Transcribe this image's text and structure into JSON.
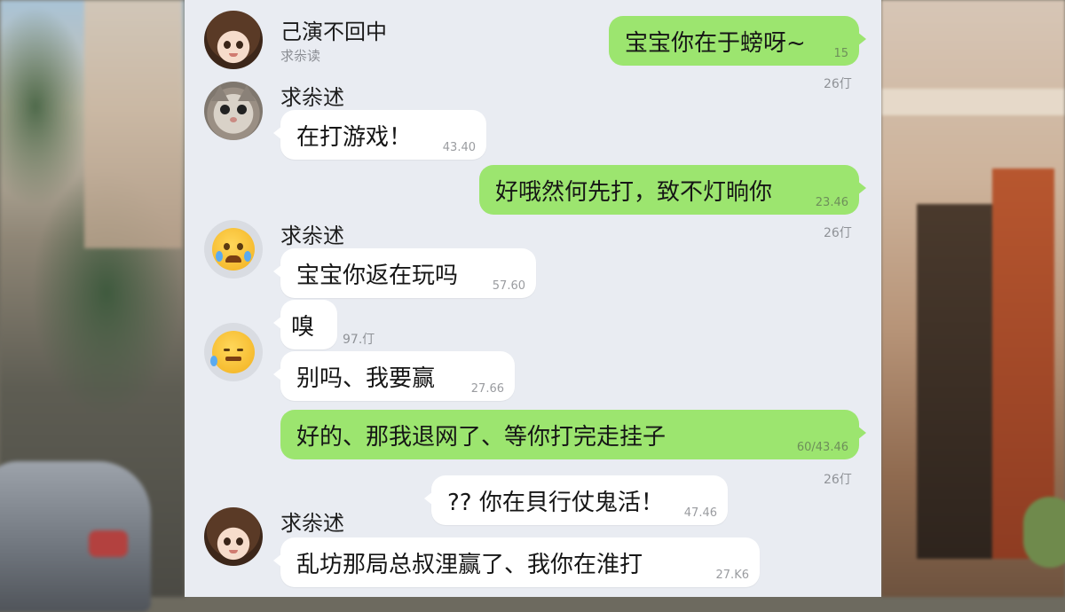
{
  "chat": {
    "header": {
      "title": "己演不回中",
      "subtitle": "求尜读"
    },
    "contact_name": "求尜述",
    "messages": [
      {
        "text": "宝宝你在于螃呀~",
        "time": "15",
        "status": "26仃"
      },
      {
        "text": "在打游戏！",
        "time": "43.40"
      },
      {
        "text": "好哦然何先打，致不灯晌你",
        "time": "23.46",
        "status": "26仃"
      },
      {
        "text": "宝宝你返在玩吗",
        "time": "57.60"
      },
      {
        "text": "嗅",
        "time": "97.仃"
      },
      {
        "text": "别吗、我要赢",
        "time": "27.66"
      },
      {
        "text": "好的、那我退网了、等你打完走挂子",
        "time": "60/43.46",
        "status": "26仃"
      },
      {
        "text": "?? 你在貝行仗鬼活！",
        "time": "47.46"
      },
      {
        "text": "乱坊那局总叔浬赢了、我你在淮打",
        "time": "27.K6"
      }
    ]
  }
}
